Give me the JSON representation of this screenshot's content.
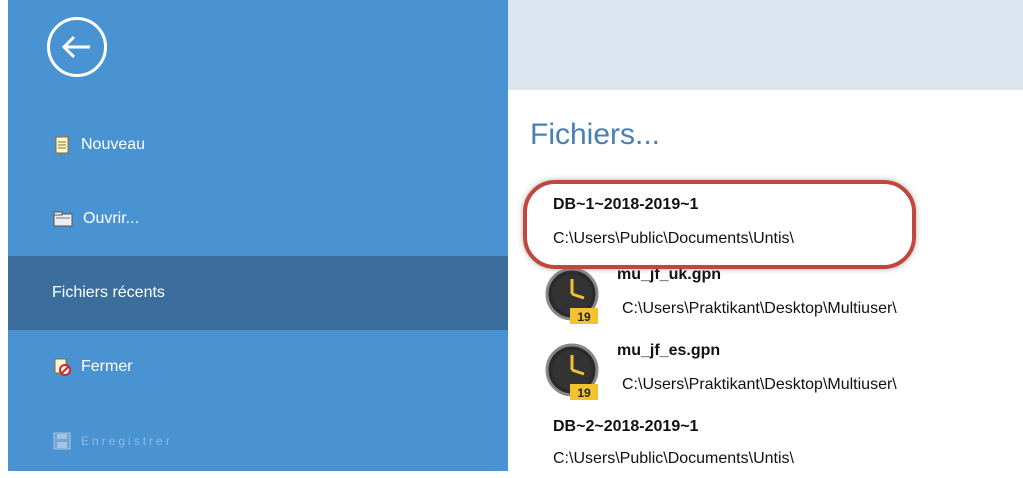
{
  "colors": {
    "sidebar_bg": "#4a93d3",
    "selected_bg": "#3b6e9c",
    "header_bg": "#dbe6f1",
    "title_color": "#4a7fb0",
    "highlight_color": "#c0473b"
  },
  "sidebar": {
    "back_icon": "back-arrow-icon",
    "items": [
      {
        "label": "Nouveau",
        "icon": "new-document-icon"
      },
      {
        "label": "Ouvrir...",
        "icon": "open-folder-icon"
      },
      {
        "label": "Fichiers récents",
        "icon": ""
      },
      {
        "label": "Fermer",
        "icon": "close-document-icon"
      },
      {
        "label": "Enregistrer",
        "icon": "save-icon"
      }
    ]
  },
  "main": {
    "title": "Fichiers...",
    "files": [
      {
        "name": "DB~1~2018-2019~1",
        "path": "C:\\Users\\Public\\Documents\\Untis\\",
        "icon": ""
      },
      {
        "name": "mu_jf_uk.gpn",
        "path": "C:\\Users\\Praktikant\\Desktop\\Multiuser\\",
        "icon": "clock-file-icon",
        "badge": "19"
      },
      {
        "name": "mu_jf_es.gpn",
        "path": "C:\\Users\\Praktikant\\Desktop\\Multiuser\\",
        "icon": "clock-file-icon",
        "badge": "19"
      },
      {
        "name": "DB~2~2018-2019~1",
        "path": "C:\\Users\\Public\\Documents\\Untis\\",
        "icon": ""
      }
    ]
  }
}
